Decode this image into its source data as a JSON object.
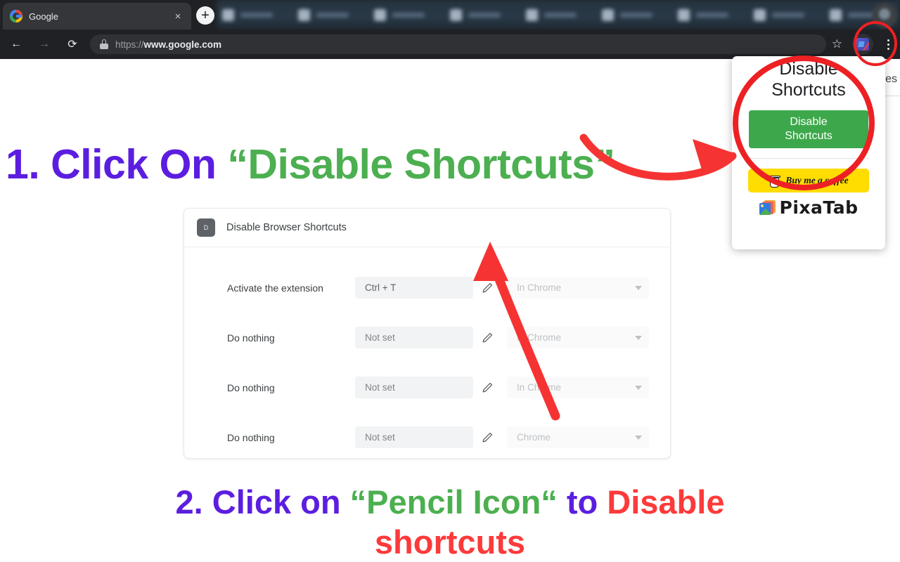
{
  "browser": {
    "active_tab": {
      "title": "Google",
      "favicon": "google-icon",
      "close_label": "×"
    },
    "new_tab_label": "+",
    "background_tab_count": 9,
    "toolbar": {
      "back_label": "←",
      "forward_label": "→",
      "reload_label": "⟳",
      "lock_icon": "lock-icon",
      "url_scheme": "https://",
      "url_domain": "www.google.com",
      "bookmark_star": "☆",
      "extension_icon": "disable-browser-shortcuts-icon",
      "menu_label": "kebab-menu-icon"
    }
  },
  "page_residue": {
    "cut_text": "ges"
  },
  "step1": {
    "number": "1. ",
    "verb": "Click On ",
    "quote_open": "“",
    "target": "Disable Shortcuts",
    "quote_close": "”"
  },
  "step2": {
    "line1_number": "2. ",
    "line1_verb": "Click on ",
    "line1_quote_open": "“",
    "line1_target": "Pencil Icon",
    "line1_quote_close": "“",
    "line1_mid": " to ",
    "line1_action": "Disable",
    "line2_action": "shortcuts"
  },
  "settings_card": {
    "extension_badge": "D",
    "title": "Disable Browser Shortcuts",
    "rows": [
      {
        "label": "Activate the extension",
        "shortcut": "Ctrl + T",
        "is_set": true,
        "edit_icon": "pencil-icon",
        "scope": "In Chrome"
      },
      {
        "label": "Do nothing",
        "shortcut": "Not set",
        "is_set": false,
        "edit_icon": "pencil-icon",
        "scope": "In Chrome"
      },
      {
        "label": "Do nothing",
        "shortcut": "Not set",
        "is_set": false,
        "edit_icon": "pencil-icon",
        "scope": "In Chrome"
      },
      {
        "label": "Do nothing",
        "shortcut": "Not set",
        "is_set": false,
        "edit_icon": "pencil-icon",
        "scope": "Chrome"
      }
    ]
  },
  "extension_popup": {
    "title": "Disable Shortcuts",
    "cta_line1": "Disable",
    "cta_line2": "Shortcuts",
    "coffee_label": "Buy me a coffee",
    "coffee_icon": "coffee-cup-icon",
    "brand_label": "PixaTab",
    "brand_icon": "pixatab-logo-icon"
  },
  "annotations": {
    "circle_color": "#ED2024",
    "arrow_color": "#F63333",
    "arrow_to_popup": "curved-arrow-right",
    "arrow_to_pencil": "curved-arrow-up",
    "circle_toolbar_icon": "ellipse-highlight",
    "circle_popup_cta": "ellipse-highlight"
  },
  "colors": {
    "purple": "#5B1EE0",
    "green": "#4CAF50",
    "red": "#FD3A3A",
    "cta_green": "#3DA84B",
    "coffee_yellow": "#FFDD00",
    "chrome_dark": "#202124"
  }
}
